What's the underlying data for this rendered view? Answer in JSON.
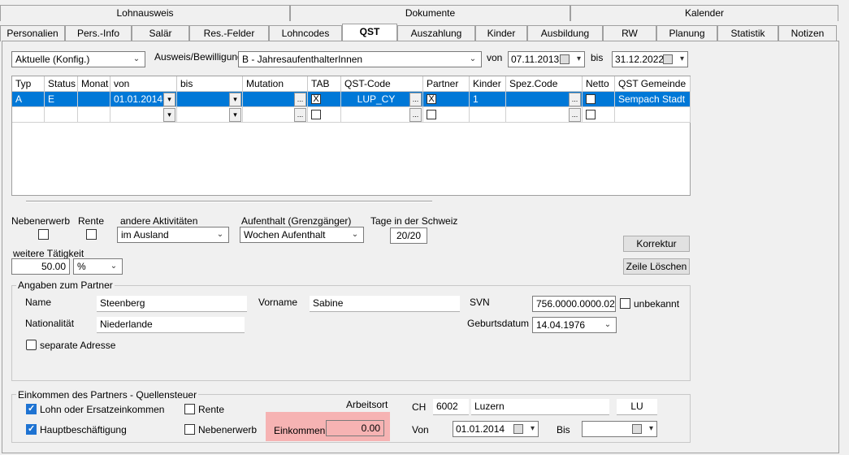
{
  "tabs_row1": [
    "Lohnausweis",
    "Dokumente",
    "Kalender"
  ],
  "tabs_row2": [
    "Personalien",
    "Pers.-Info",
    "Salär",
    "Res.-Felder",
    "Lohncodes",
    "QST",
    "Auszahlung",
    "Kinder",
    "Ausbildung",
    "RW",
    "Planung",
    "Statistik",
    "Notizen"
  ],
  "active_tab": "QST",
  "filter": {
    "mode": "Aktuelle (Konfig.)",
    "ausweis_label": "Ausweis/Bewilligung",
    "ausweis_value": "B - JahresaufenthalterInnen",
    "von_label": "von",
    "von_value": "07.11.2013",
    "bis_label": "bis",
    "bis_value": "31.12.2022"
  },
  "grid": {
    "headers": [
      "Typ",
      "Status",
      "Monat",
      "von",
      "bis",
      "Mutation",
      "TAB",
      "QST-Code",
      "Partner",
      "Kinder",
      "Spez.Code",
      "Netto",
      "QST Gemeinde"
    ],
    "row1": {
      "typ": "A",
      "status": "E",
      "monat": "",
      "von": "01.01.2014",
      "bis": "",
      "mutation": "",
      "tab": "X",
      "qst_code": "LUP_CY",
      "partner": "X",
      "kinder": "1",
      "spez_code": "",
      "netto": "",
      "gemeinde": "Sempach Stadt"
    },
    "ellipsis": "...",
    "dropdown": "▾"
  },
  "options": {
    "nebenerwerb_label": "Nebenerwerb",
    "rente_label": "Rente",
    "andere_label": "andere Aktivitäten",
    "andere_value": "im Ausland",
    "aufenthalt_label": "Aufenthalt (Grenzgänger)",
    "aufenthalt_value": "Wochen Aufenthalt",
    "tage_label": "Tage in der Schweiz",
    "tage_value": "20/20",
    "weitere_label": "weitere Tätigkeit",
    "weitere_value": "50.00",
    "weitere_unit": "%"
  },
  "buttons": {
    "korrektur": "Korrektur",
    "zeile_loeschen": "Zeile Löschen"
  },
  "partner": {
    "title": "Angaben zum Partner",
    "name_label": "Name",
    "name_value": "Steenberg",
    "vorname_label": "Vorname",
    "vorname_value": "Sabine",
    "svn_label": "SVN",
    "svn_value": "756.0000.0000.02",
    "unbekannt_label": "unbekannt",
    "nationalitaet_label": "Nationalität",
    "nationalitaet_value": "Niederlande",
    "geburtsdatum_label": "Geburtsdatum",
    "geburtsdatum_value": "14.04.1976",
    "separate_label": "separate Adresse"
  },
  "einkommen": {
    "title": "Einkommen des Partners - Quellensteuer",
    "lohn_label": "Lohn oder Ersatzeinkommen",
    "rente_label": "Rente",
    "haupt_label": "Hauptbeschäftigung",
    "neben_label": "Nebenerwerb",
    "arbeitsort_label": "Arbeitsort",
    "land": "CH",
    "plz": "6002",
    "ort": "Luzern",
    "kanton": "LU",
    "einkommen_label": "Einkommen",
    "einkommen_value": "0.00",
    "von_label": "Von",
    "von_value": "01.01.2014",
    "bis_label": "Bis",
    "bis_value": ""
  },
  "colors": {
    "selection": "#0078d7",
    "highlight": "#f6b3b3",
    "checked": "#1e73d2"
  }
}
